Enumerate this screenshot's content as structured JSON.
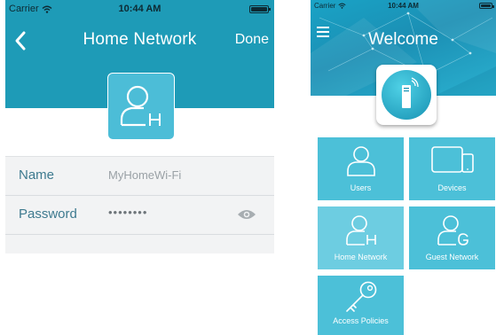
{
  "left_screen": {
    "status_bar": {
      "carrier": "Carrier",
      "time": "10:44 AM"
    },
    "nav": {
      "title": "Home Network",
      "done_label": "Done",
      "back_icon": "chevron-left-icon"
    },
    "avatar_icon": "home-network-user-icon",
    "form": {
      "name_label": "Name",
      "name_value": "MyHomeWi-Fi",
      "password_label": "Password",
      "password_value": "••••••••",
      "reveal_icon": "eye-icon"
    }
  },
  "right_screen": {
    "status_bar": {
      "carrier": "Carrier",
      "time": "10:44 AM"
    },
    "menu_icon": "hamburger-menu-icon",
    "title": "Welcome",
    "logo_icon": "router-icon",
    "tiles": [
      {
        "label": "Users",
        "icon": "user-icon"
      },
      {
        "label": "Devices",
        "icon": "devices-icon"
      },
      {
        "label": "Home Network",
        "icon": "home-network-user-icon"
      },
      {
        "label": "Guest Network",
        "icon": "guest-network-user-icon"
      },
      {
        "label": "Access Policies",
        "icon": "key-icon"
      }
    ]
  },
  "colors": {
    "header_teal": "#1e9bb7",
    "tile_teal": "#4cc0d8",
    "label_teal": "#3e7a8f",
    "value_gray": "#9aa1a6",
    "form_bg": "#f2f3f4"
  }
}
